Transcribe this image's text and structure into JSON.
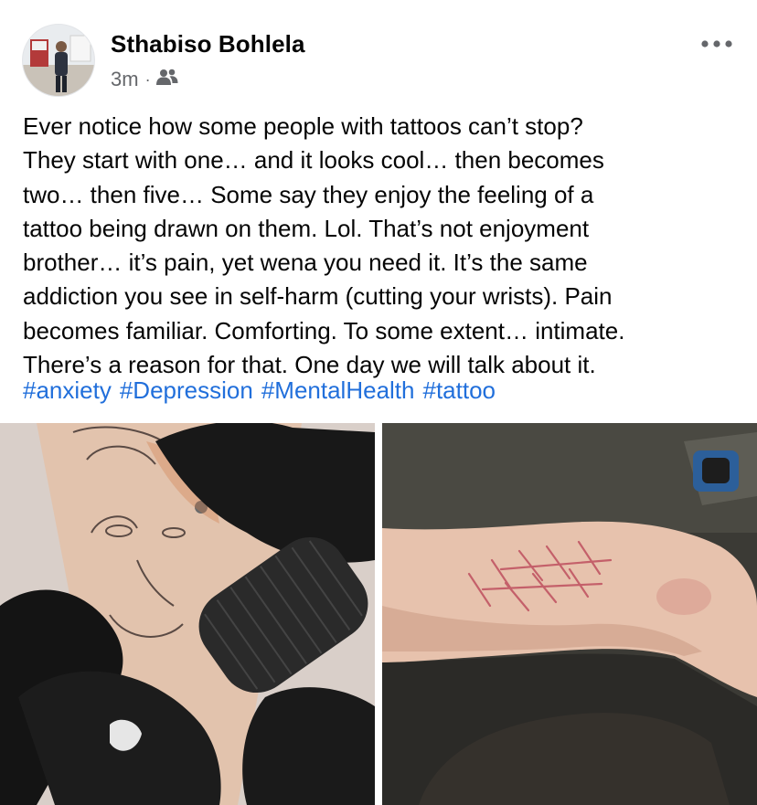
{
  "post": {
    "author": {
      "name": "Sthabiso Bohlela",
      "avatar_icon": "profile-photo"
    },
    "meta": {
      "time": "3m",
      "separator": "·",
      "audience_icon": "friends-icon"
    },
    "more_icon": "ellipsis-icon",
    "text": "Ever notice how some people with tattoos can’t stop?\nThey start with one… and it looks cool… then becomes\ntwo… then five… Some say they enjoy the feeling of a\ntattoo being drawn on them. Lol. That’s not enjoyment\nbrother… it’s pain, yet wena you need it. It’s the same\naddiction you see in self-harm (cutting your wrists). Pain\nbecomes familiar. Comforting. To some extent… intimate.\nThere’s a reason for that. One day we will talk about it.",
    "hashtags": [
      "#anxiety",
      "#Depression",
      "#MentalHealth",
      "#tattoo"
    ],
    "photos": [
      {
        "subject": "tattoo-being-drawn-photo"
      },
      {
        "subject": "scarred-wrist-photo"
      }
    ]
  },
  "colors": {
    "text": "#050505",
    "secondary": "#65676b",
    "link": "#216fdb",
    "background": "#ffffff"
  }
}
